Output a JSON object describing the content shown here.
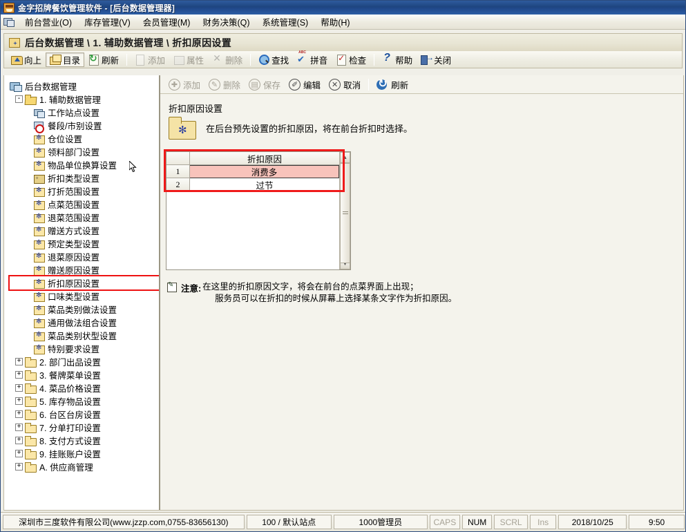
{
  "window": {
    "title": "金字招牌餐饮管理软件 - [后台数据管理器]",
    "app_icon": "app-logo-icon"
  },
  "menubar": {
    "mdi_icon": "mdi-window-icon",
    "items": [
      {
        "label": "前台营业(O)"
      },
      {
        "label": "库存管理(V)"
      },
      {
        "label": "会员管理(M)"
      },
      {
        "label": "财务决策(Q)"
      },
      {
        "label": "系统管理(S)"
      },
      {
        "label": "帮助(H)"
      }
    ]
  },
  "breadcrumb": {
    "icon": "blue-star-folder-icon",
    "text": "后台数据管理 \\ 1. 辅助数据管理 \\ 折扣原因设置"
  },
  "main_toolbar": {
    "buttons": [
      {
        "label": "向上",
        "icon": "folder-up-icon",
        "enabled": true,
        "pressed": false
      },
      {
        "label": "目录",
        "icon": "folder-list-icon",
        "enabled": true,
        "pressed": true
      },
      {
        "label": "刷新",
        "icon": "refresh-page-icon",
        "enabled": true,
        "pressed": false
      },
      {
        "label": "添加",
        "icon": "add-document-icon",
        "enabled": false,
        "pressed": false
      },
      {
        "label": "属性",
        "icon": "properties-icon",
        "enabled": false,
        "pressed": false
      },
      {
        "label": "删除",
        "icon": "delete-x-icon",
        "enabled": false,
        "pressed": false
      },
      {
        "label": "查找",
        "icon": "search-magnifier-icon",
        "enabled": true,
        "pressed": false
      },
      {
        "label": "拼音",
        "icon": "pinyin-abc-icon",
        "enabled": true,
        "pressed": false
      },
      {
        "label": "检查",
        "icon": "checklist-icon",
        "enabled": true,
        "pressed": false
      },
      {
        "label": "帮助",
        "icon": "question-mark-icon",
        "enabled": true,
        "pressed": false
      },
      {
        "label": "关闭",
        "icon": "exit-door-icon",
        "enabled": true,
        "pressed": false
      }
    ]
  },
  "tree": {
    "root": {
      "label": "后台数据管理",
      "icon": "computer-database-icon"
    },
    "nodes": [
      {
        "label": "1. 辅助数据管理",
        "icon": "folder-open-icon",
        "expander": "-",
        "depth": 1
      },
      {
        "label": "工作站点设置",
        "icon": "workstation-icon",
        "depth": 2
      },
      {
        "label": "餐段/市别设置",
        "icon": "clock-schedule-icon",
        "depth": 2
      },
      {
        "label": "仓位设置",
        "icon": "star-folder-icon",
        "depth": 2
      },
      {
        "label": "领料部门设置",
        "icon": "star-folder-icon",
        "depth": 2
      },
      {
        "label": "物品单位换算设置",
        "icon": "star-folder-icon",
        "depth": 2
      },
      {
        "label": "折扣类型设置",
        "icon": "dark-folder-icon",
        "depth": 2
      },
      {
        "label": "打折范围设置",
        "icon": "star-folder-icon",
        "depth": 2
      },
      {
        "label": "点菜范围设置",
        "icon": "star-folder-icon",
        "depth": 2
      },
      {
        "label": "退菜范围设置",
        "icon": "star-folder-icon",
        "depth": 2
      },
      {
        "label": "赠送方式设置",
        "icon": "star-folder-icon",
        "depth": 2
      },
      {
        "label": "预定类型设置",
        "icon": "star-folder-icon",
        "depth": 2
      },
      {
        "label": "退菜原因设置",
        "icon": "star-folder-icon",
        "depth": 2
      },
      {
        "label": "赠送原因设置",
        "icon": "star-folder-icon",
        "depth": 2
      },
      {
        "label": "折扣原因设置",
        "icon": "star-folder-icon",
        "depth": 2,
        "highlighted": true
      },
      {
        "label": "口味类型设置",
        "icon": "star-folder-icon",
        "depth": 2
      },
      {
        "label": "菜品类别做法设置",
        "icon": "star-folder-icon",
        "depth": 2
      },
      {
        "label": "通用做法组合设置",
        "icon": "star-folder-icon",
        "depth": 2
      },
      {
        "label": "菜品类别状型设置",
        "icon": "star-folder-icon",
        "depth": 2
      },
      {
        "label": "特别要求设置",
        "icon": "star-folder-icon",
        "depth": 2
      },
      {
        "label": "2. 部门出品设置",
        "icon": "folder-icon",
        "expander": "+",
        "depth": 1
      },
      {
        "label": "3. 餐牌菜单设置",
        "icon": "folder-icon",
        "expander": "+",
        "depth": 1
      },
      {
        "label": "4. 菜品价格设置",
        "icon": "folder-icon",
        "expander": "+",
        "depth": 1
      },
      {
        "label": "5. 库存物品设置",
        "icon": "folder-icon",
        "expander": "+",
        "depth": 1
      },
      {
        "label": "6. 台区台房设置",
        "icon": "folder-icon",
        "expander": "+",
        "depth": 1
      },
      {
        "label": "7. 分单打印设置",
        "icon": "folder-icon",
        "expander": "+",
        "depth": 1
      },
      {
        "label": "8. 支付方式设置",
        "icon": "folder-icon",
        "expander": "+",
        "depth": 1
      },
      {
        "label": "9. 挂账账户设置",
        "icon": "folder-icon",
        "expander": "+",
        "depth": 1
      },
      {
        "label": "A. 供应商管理",
        "icon": "folder-icon",
        "expander": "+",
        "depth": 1
      }
    ]
  },
  "sub_toolbar": {
    "buttons": [
      {
        "label": "添加",
        "icon": "add-circle-icon",
        "glyph": "✚",
        "enabled": false
      },
      {
        "label": "删除",
        "icon": "delete-circle-icon",
        "glyph": "✎",
        "enabled": false
      },
      {
        "label": "保存",
        "icon": "save-circle-icon",
        "glyph": "▤",
        "enabled": false
      },
      {
        "label": "编辑",
        "icon": "edit-circle-icon",
        "glyph": "✐",
        "enabled": true
      },
      {
        "label": "取消",
        "icon": "cancel-circle-icon",
        "glyph": "✕",
        "enabled": true
      },
      {
        "label": "刷新",
        "icon": "refresh-blue-icon",
        "glyph": "↻",
        "enabled": true
      }
    ]
  },
  "panel": {
    "title": "折扣原因设置",
    "folder_icon": "big-star-folder-icon",
    "description": "在后台预先设置的折扣原因，将在前台折扣时选择。"
  },
  "grid": {
    "column_header": "折扣原因",
    "rows": [
      {
        "num": "1",
        "value": "消费多",
        "selected": true
      },
      {
        "num": "2",
        "value": "过节",
        "selected": false
      }
    ],
    "scrollbar": {
      "up_glyph": "▲",
      "down_glyph": "▼"
    }
  },
  "note": {
    "icon": "note-pencil-icon",
    "label": "注意:",
    "line1": "在这里的折扣原因文字，将会在前台的点菜界面上出现；",
    "line2": "服务员可以在折扣的时候从屏幕上选择某条文字作为折扣原因。"
  },
  "statusbar": {
    "company": "深圳市三度软件有限公司(www.jzzp.com,0755-83656130)",
    "station": "100 / 默认站点",
    "operator": "1000管理员",
    "caps": "CAPS",
    "num": "NUM",
    "scrl": "SCRL",
    "ins": "Ins",
    "date": "2018/10/25",
    "time": "9:50"
  },
  "colors": {
    "title_bar": "#1e457f",
    "selected_row": "#f8c3bb",
    "highlight_box": "#ef1a1a",
    "panel_bg": "#f4f3ec"
  }
}
